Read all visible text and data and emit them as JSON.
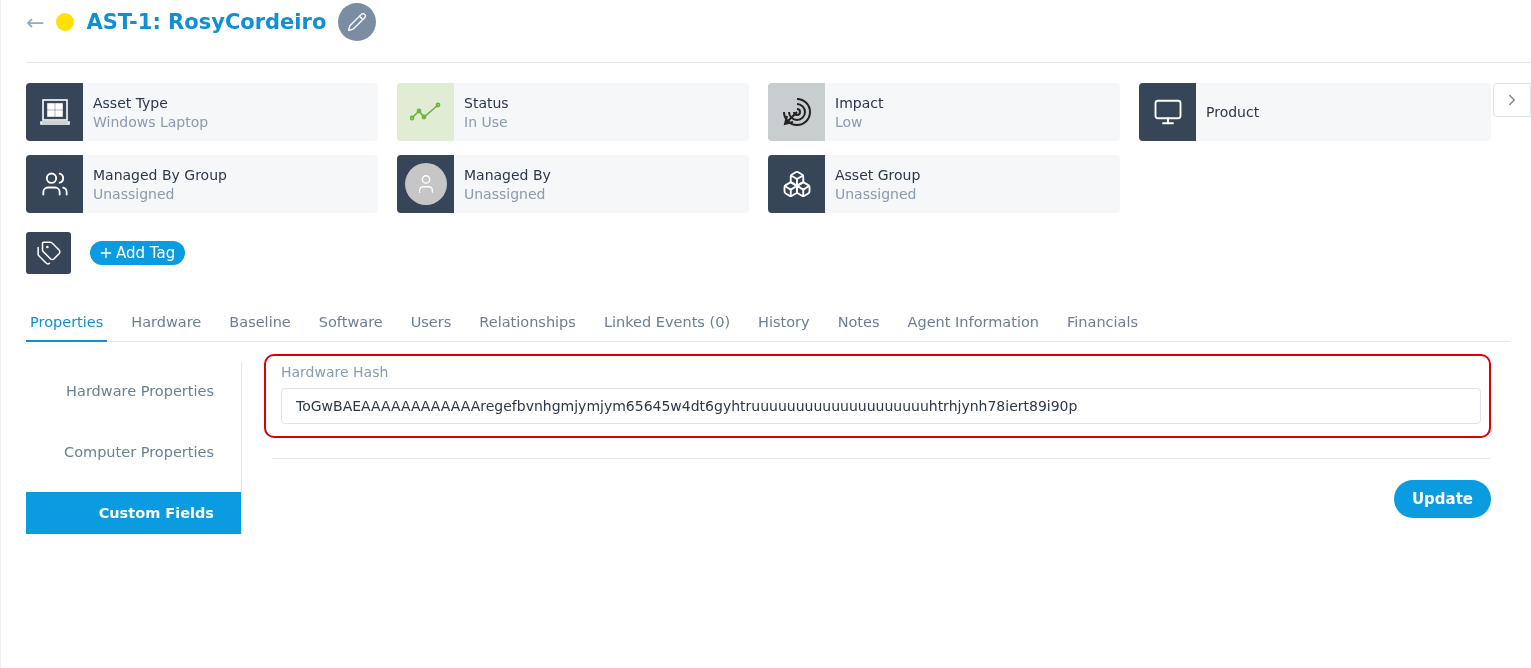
{
  "header": {
    "back": "←",
    "title": "AST-1: RosyCordeiro"
  },
  "cards": [
    {
      "label": "Asset Type",
      "value": "Windows Laptop"
    },
    {
      "label": "Status",
      "value": "In Use"
    },
    {
      "label": "Impact",
      "value": "Low"
    },
    {
      "label": "Product"
    },
    {
      "label": "Managed By Group",
      "value": "Unassigned"
    },
    {
      "label": "Managed By",
      "value": "Unassigned"
    },
    {
      "label": "Asset Group",
      "value": "Unassigned"
    }
  ],
  "add_tag": "Add Tag",
  "tabs": [
    {
      "label": "Properties",
      "selected": true
    },
    {
      "label": "Hardware",
      "selected": false
    },
    {
      "label": "Baseline",
      "selected": false
    },
    {
      "label": "Software",
      "selected": false
    },
    {
      "label": "Users",
      "selected": false
    },
    {
      "label": "Relationships",
      "selected": false
    },
    {
      "label": "Linked Events (0)",
      "selected": false
    },
    {
      "label": "History",
      "selected": false
    },
    {
      "label": "Notes",
      "selected": false
    },
    {
      "label": "Agent Information",
      "selected": false
    },
    {
      "label": "Financials",
      "selected": false
    }
  ],
  "side_nav": [
    {
      "label": "Hardware Properties",
      "selected": false
    },
    {
      "label": "Computer Properties",
      "selected": false
    },
    {
      "label": "Custom Fields",
      "selected": true
    }
  ],
  "field": {
    "label": "Hardware Hash",
    "value": "ToGwBAEAAAAAAAAAAAAregefbvnhgmjymjym65645w4dt6gyhtruuuuuuuuuuuuuuuuuuuuhtrhjynh78iert89i90p",
    "highlighted": true
  },
  "update_button": "Update"
}
